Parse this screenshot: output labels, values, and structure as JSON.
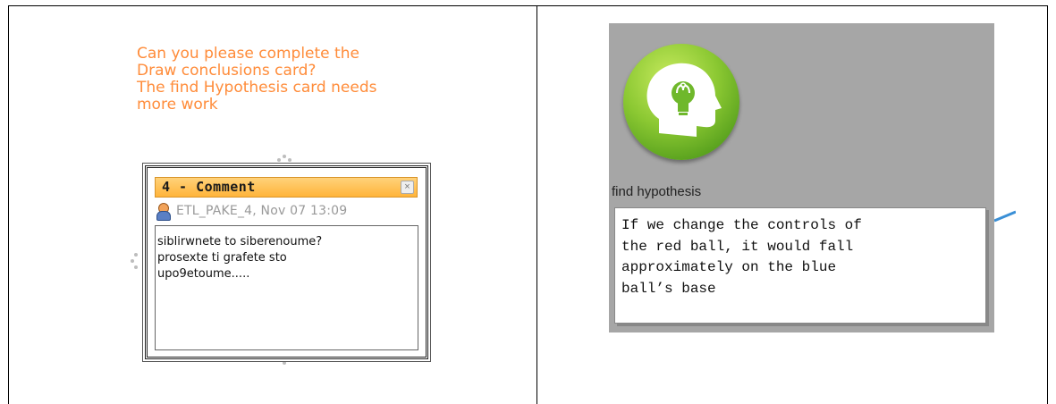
{
  "note": {
    "lines": [
      "Can you please complete the",
      "Draw conclusions card?",
      "The find Hypothesis card needs",
      "more work"
    ]
  },
  "comment_card": {
    "title": "4 - Comment",
    "close_symbol": "×",
    "author_line": "ETL_PAKE_4, Nov 07 13:09",
    "body_lines": [
      "siblirwnete to siberenoume?",
      "prosexte ti grafete sto",
      "upo9etoume....."
    ]
  },
  "hypothesis_card": {
    "icon": "head-lightbulb-icon",
    "label": "find hypothesis",
    "text_lines": [
      "If we change the controls of",
      "the red ball, it would fall",
      "approximately on the blue",
      "ball’s base"
    ]
  },
  "colors": {
    "note_text": "#ff8c3a",
    "comment_header": "#ffb43a",
    "panel_background": "#a6a6a6",
    "icon_green": "#8bc832",
    "connector_blue": "#3a8fd6"
  }
}
